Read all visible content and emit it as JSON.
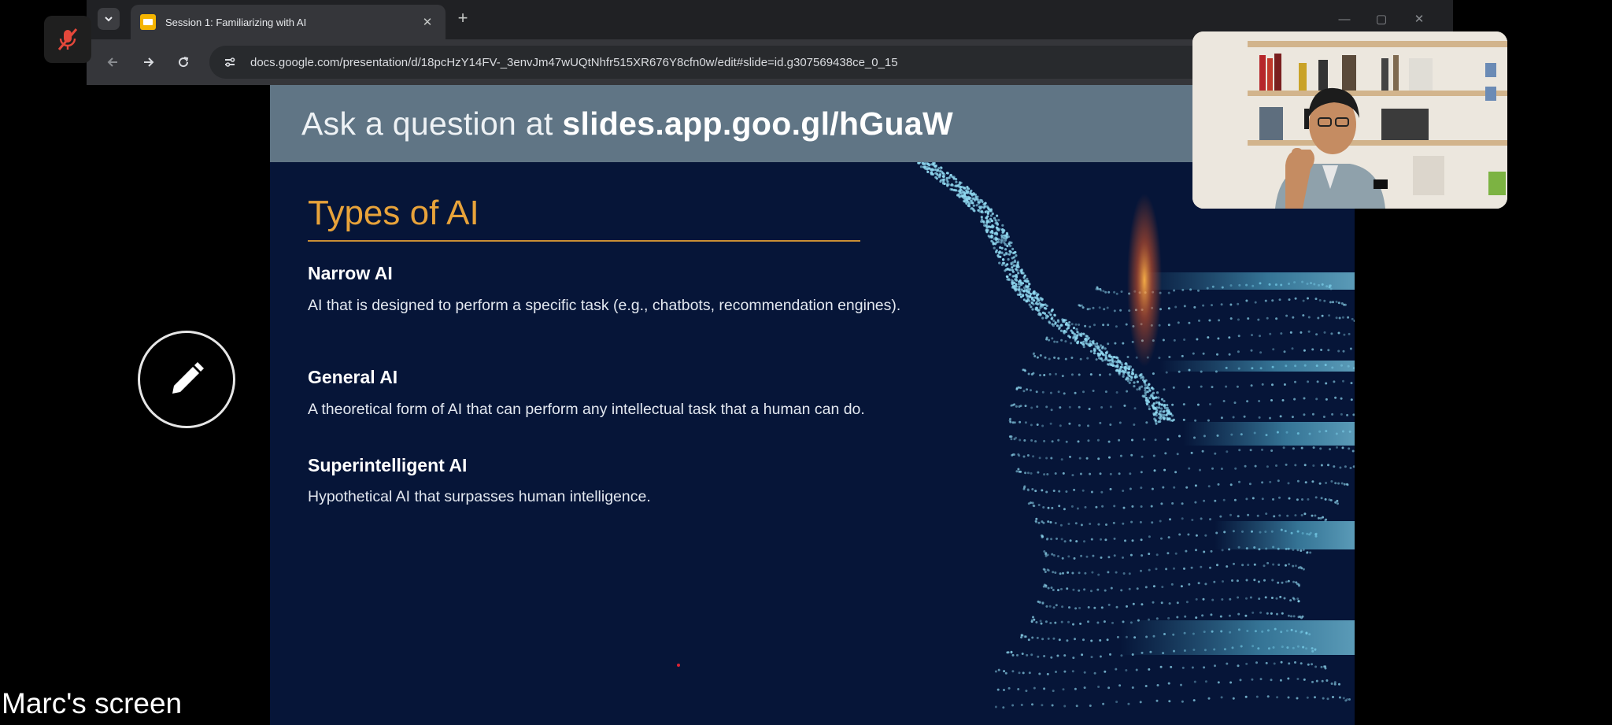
{
  "meeting": {
    "presenter_label": "Marc's screen",
    "mic_icon": "mic-off-icon",
    "annotate_icon": "pencil-icon"
  },
  "browser": {
    "tab": {
      "title": "Session 1: Familiarizing with AI",
      "favicon": "google-slides-icon"
    },
    "url": "docs.google.com/presentation/d/18pcHzY14FV-_3envJm47wUQtNhfr515XR676Y8cfn0w/edit#slide=id.g307569438ce_0_15"
  },
  "slide": {
    "qa_banner": {
      "lead": "Ask a question at ",
      "link": "slides.app.goo.gl/hGuaW"
    },
    "title": "Types of AI",
    "items": [
      {
        "heading": "Narrow AI",
        "body": "AI that is designed to perform a specific task (e.g., chatbots, recommendation engines)."
      },
      {
        "heading": "General AI",
        "body": "A theoretical form of AI that can perform any intellectual task that a human can do."
      },
      {
        "heading": "Superintelligent AI",
        "body": "Hypothetical AI that surpasses human intelligence."
      }
    ]
  },
  "colors": {
    "slide_background": "#061538",
    "title_accent": "#e8a33a",
    "qa_banner": "#607585",
    "figure_dots": "#8fd8f0"
  }
}
